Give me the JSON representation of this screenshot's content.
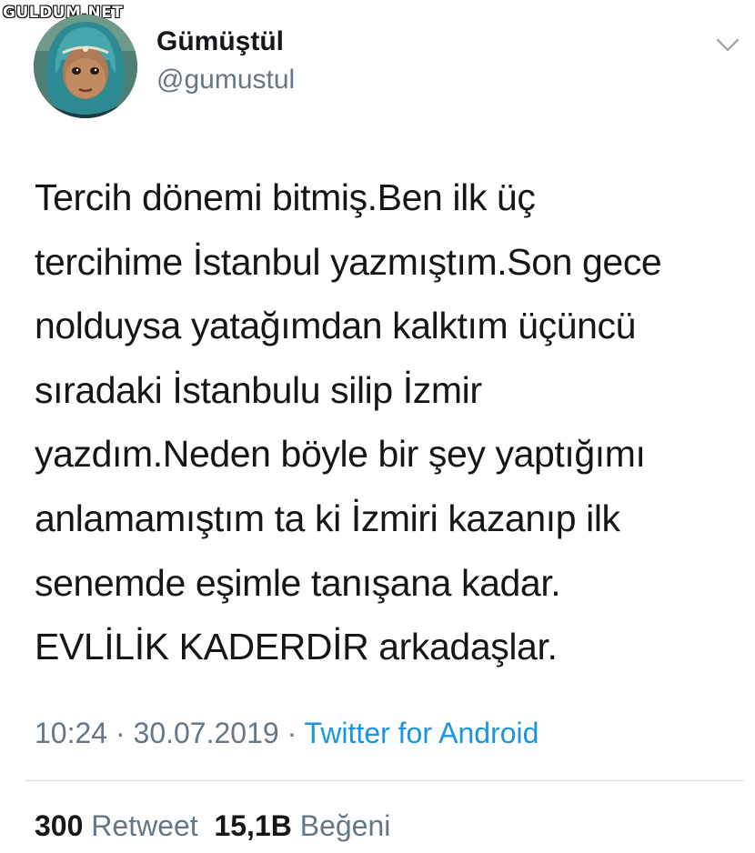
{
  "watermark": "GULDUM.NET",
  "user": {
    "display_name": "Gümüştül",
    "handle": "@gumustul",
    "avatar": "avatar-photo"
  },
  "menu_icon": "chevron-down-icon",
  "tweet": {
    "lines": [
      "Tercih dönemi bitmiş.Ben ilk üç",
      "tercihime İstanbul yazmıştım.Son gece",
      "nolduysa yatağımdan kalktım üçüncü",
      "sıradaki İstanbulu silip İzmir",
      "yazdım.Neden böyle bir şey yaptığımı",
      "anlamamıştım ta ki İzmiri kazanıp ilk",
      "senemde eşimle tanışana kadar.",
      "EVLİLİK KADERDİR arkadaşlar."
    ]
  },
  "meta": {
    "time": "10:24",
    "separator": " · ",
    "date": "30.07.2019",
    "separator2": " · ",
    "source": "Twitter for Android"
  },
  "stats": {
    "retweet_count": "300",
    "retweet_label": "Retweet",
    "like_count": "15,1B",
    "like_label": "Beğeni"
  },
  "colors": {
    "text": "#14171a",
    "secondary": "#657786",
    "link": "#1b95e0",
    "divider": "#d8dde2"
  }
}
